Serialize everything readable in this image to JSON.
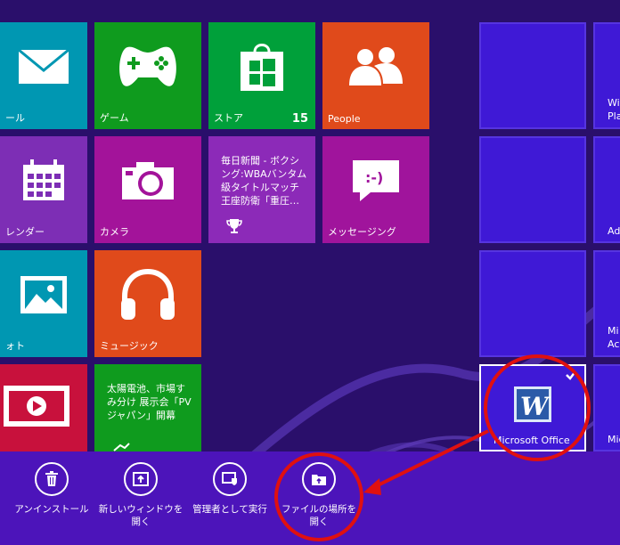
{
  "tiles": {
    "mail": {
      "label": "ール"
    },
    "games": {
      "label": "ゲーム"
    },
    "store": {
      "label": "ストア",
      "badge": "15"
    },
    "people": {
      "label": "People"
    },
    "calendar": {
      "label": "レンダー"
    },
    "camera": {
      "label": "カメラ"
    },
    "news": {
      "text": "毎日新聞 - ボクシング:WBAバンタム級タイトルマッチ 王座防衛「重圧…"
    },
    "messaging": {
      "label": "メッセージング"
    },
    "photos": {
      "label": "ォト"
    },
    "music": {
      "label": "ミュージック"
    },
    "finance": {
      "text": "太陽電池、市場すみ分け 展示会「PVジャパン」開幕"
    },
    "word": {
      "label": "Microsoft Office"
    },
    "right_col": [
      "Wi",
      "Pla",
      "Ad",
      "Mi",
      "Ac",
      "Mic"
    ]
  },
  "appbar": {
    "uninstall": "アンインストール",
    "new_window": [
      "新しいウィンドウを",
      "開く"
    ],
    "run_admin": "管理者として実行",
    "open_location": [
      "ファイルの場所を",
      "開く"
    ]
  },
  "colors": {
    "background": "#2a0f6b",
    "appbar": "#4c14ba",
    "selected_tile": "#3f19d6",
    "annotation": "#e01010"
  }
}
